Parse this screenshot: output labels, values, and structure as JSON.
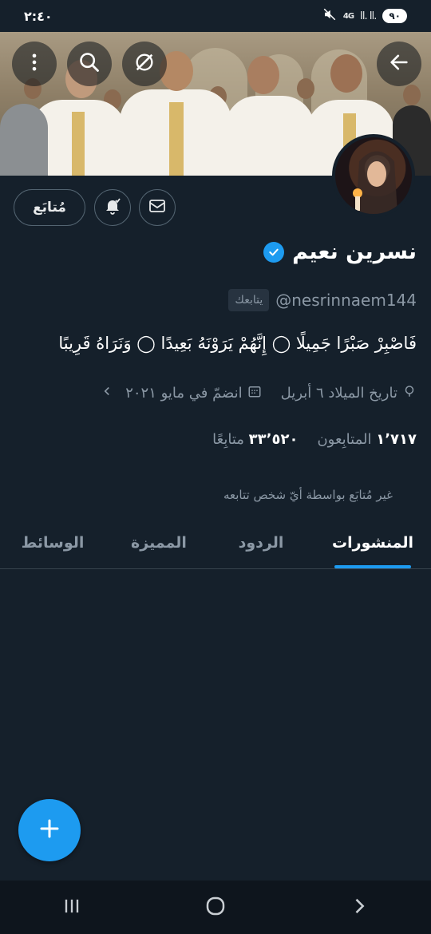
{
  "status_bar": {
    "time": "٢:٤٠",
    "battery": "٩٠",
    "signal": "Il. Il.",
    "network": "4G"
  },
  "profile": {
    "follow_label": "مُتابَع",
    "name": "نسرين نعيم",
    "handle": "@nesrinnaem144",
    "follows_you": "يتابعك",
    "bio": "فَاصْبِرْ صَبْرًا جَمِيلًا ◯ إِنَّهُمْ يَرَوْنَهُ بَعِيدًا ◯ وَنَرَاهُ قَرِيبًا",
    "birthday": "تاريخ الميلاد ٦ أبريل",
    "joined": "انضمّ في مايو ٢٠٢١",
    "followers_count": "١٬٧١٧",
    "followers_label": "المتابِعون",
    "following_count": "٣٣٬٥٢٠",
    "following_label": "متابِعًا",
    "not_followed_note": "غير مُتابَع بواسطة أيّ شخص تتابعه"
  },
  "tabs": [
    {
      "label": "المنشورات",
      "active": true
    },
    {
      "label": "الردود",
      "active": false
    },
    {
      "label": "المميزة",
      "active": false
    },
    {
      "label": "الوسائط",
      "active": false
    }
  ],
  "icons": {
    "back": "arrow-left-icon",
    "grok": "grok-icon",
    "search": "search-icon",
    "more": "more-vertical-icon",
    "message": "mail-icon",
    "notify": "bell-icon",
    "verified": "verified-badge-icon",
    "location": "location-pin-icon",
    "calendar": "calendar-icon",
    "compose": "plus-icon"
  },
  "colors": {
    "background": "#15202b",
    "accent": "#1d9bf0",
    "secondary_text": "#8b98a5"
  }
}
